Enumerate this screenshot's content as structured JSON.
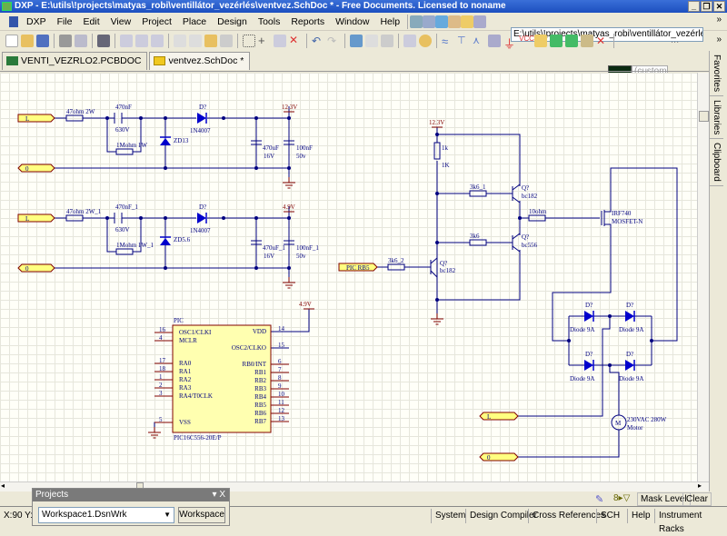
{
  "window": {
    "title": "DXP - E:\\utils\\!projects\\matyas_robi\\ventillátor_vezérlés\\ventvez.SchDoc * - Free Documents. Licensed to noname"
  },
  "menu": [
    "DXP",
    "File",
    "Edit",
    "View",
    "Project",
    "Place",
    "Design",
    "Tools",
    "Reports",
    "Window",
    "Help"
  ],
  "toolbar": {
    "path": "E:\\utils\\!projects\\matyas_robi\\ventillátor_vezérlés\\ver",
    "color_select": "(custom",
    "ellipsis": "...",
    "chevron": "»"
  },
  "tabs": [
    {
      "label": "VENTI_VEZRLO2.PCBDOC",
      "active": false
    },
    {
      "label": "ventvez.SchDoc *",
      "active": true
    }
  ],
  "side_tabs": [
    "Favorites",
    "Libraries",
    "Clipboard"
  ],
  "colors": {
    "wire": "#000080",
    "component": "#0000cc",
    "power": "#800000",
    "port_fill": "#ffff80",
    "canvas": "#fffff8"
  },
  "schematic": {
    "ports": {
      "l1": "L",
      "n1": "0",
      "l2": "L",
      "n2": "0",
      "pic_rb5": "PIC RB5",
      "l3": "L",
      "n3": "0"
    },
    "power": {
      "v1": "12.3V",
      "v2": "4.9V",
      "v3": "12.3V",
      "v4": "4.9V"
    },
    "upper": {
      "r1": "47ohm 2W",
      "c1": "470nF",
      "c1v": "630V",
      "r2": "1Mohm 1W",
      "zd": "ZD13",
      "d": "D?",
      "dname": "1N4007",
      "c2": "470uF",
      "c2v": "16V",
      "c3": "100nF",
      "c3v": "50v"
    },
    "lower": {
      "r1": "47ohm 2W_1",
      "c1": "470nF_1",
      "c1v": "630V",
      "r2": "1Mohm 1W_1",
      "zd": "ZD5.6",
      "d": "D?",
      "dname": "1N4007",
      "c2": "470uF_1",
      "c2v": "16V",
      "c3": "100nF_1",
      "c3v": "50v"
    },
    "driver": {
      "r1k": "1k",
      "r1k_val": "1K",
      "r3k6_1": "3k6_1",
      "r3k6": "3k6",
      "r3k6_2": "3k6_2",
      "r10": "10ohm",
      "q1": "Q?",
      "q1v": "bc182",
      "q2": "Q?",
      "q2v": "bc556",
      "q3": "Q?",
      "q3v": "bc182",
      "mosfet": "IRF740",
      "mosfet_type": "MOSFET-N"
    },
    "bridge": {
      "d_ref": "D?",
      "d_val": "Diode 9A",
      "motor_symbol": "M",
      "motor_val": "230VAC 280W",
      "motor_name": "Motor"
    },
    "pic": {
      "ref": "PIC",
      "part": "PIC16C556-20E/P",
      "left_pins": [
        {
          "n": "16",
          "name": "OSC1/CLKI"
        },
        {
          "n": "4",
          "name": "MCLR"
        },
        {
          "n": "17",
          "name": "RA0"
        },
        {
          "n": "18",
          "name": "RA1"
        },
        {
          "n": "1",
          "name": "RA2"
        },
        {
          "n": "2",
          "name": "RA3"
        },
        {
          "n": "3",
          "name": "RA4/T0CLK"
        },
        {
          "n": "5",
          "name": "VSS"
        }
      ],
      "right_pins": [
        {
          "n": "14",
          "name": "VDD"
        },
        {
          "n": "15",
          "name": "OSC2/CLKO"
        },
        {
          "n": "6",
          "name": "RB0/INT"
        },
        {
          "n": "7",
          "name": "RB1"
        },
        {
          "n": "8",
          "name": "RB2"
        },
        {
          "n": "9",
          "name": "RB3"
        },
        {
          "n": "10",
          "name": "RB4"
        },
        {
          "n": "11",
          "name": "RB5"
        },
        {
          "n": "12",
          "name": "RB6"
        },
        {
          "n": "13",
          "name": "RB7"
        }
      ]
    }
  },
  "maskbar": {
    "mask_level": "Mask Level",
    "clear": "Clear"
  },
  "projects_panel": {
    "title": "Projects",
    "controls": "▾ X",
    "workspace": "Workspace1.DsnWrk",
    "workspace_button": "Workspace"
  },
  "status": {
    "coords": "X:90 Y:4",
    "buttons": [
      "System",
      "Design Compiler",
      "Cross References",
      "SCH",
      "Help",
      "Instrument Racks"
    ]
  }
}
